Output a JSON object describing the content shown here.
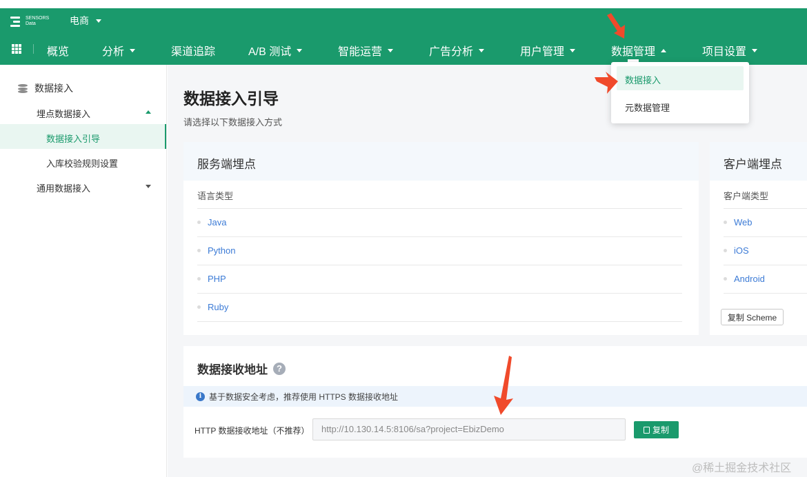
{
  "header": {
    "logo_line1": "SENSORS",
    "logo_line2": "Data",
    "project": "电商",
    "nav": [
      {
        "label": "概览",
        "dropdown": false
      },
      {
        "label": "分析",
        "dropdown": true
      },
      {
        "label": "渠道追踪",
        "dropdown": false
      },
      {
        "label": "A/B 测试",
        "dropdown": true
      },
      {
        "label": "智能运营",
        "dropdown": true
      },
      {
        "label": "广告分析",
        "dropdown": true
      },
      {
        "label": "用户管理",
        "dropdown": true
      },
      {
        "label": "数据管理",
        "dropdown": true,
        "open": true
      },
      {
        "label": "项目设置",
        "dropdown": true
      }
    ]
  },
  "dropdown_menu": {
    "items": [
      "数据接入",
      "元数据管理"
    ],
    "active": "数据接入"
  },
  "sidebar": {
    "title": "数据接入",
    "group1": "埋点数据接入",
    "sub_items": [
      "数据接入引导",
      "入库校验规则设置"
    ],
    "active": "数据接入引导",
    "group2": "通用数据接入"
  },
  "main": {
    "title": "数据接入引导",
    "subtitle": "请选择以下数据接入方式",
    "server_card": {
      "title": "服务端埋点",
      "column_label": "语言类型",
      "items": [
        "Java",
        "Python",
        "PHP",
        "Ruby"
      ]
    },
    "client_card": {
      "title": "客户端埋点",
      "column_label": "客户端类型",
      "items": [
        "Web",
        "iOS",
        "Android"
      ],
      "button": "复制 Scheme"
    },
    "receive": {
      "title": "数据接收地址",
      "help": "?",
      "notice": "基于数据安全考虑，推荐使用 HTTPS 数据接收地址",
      "address_label": "HTTP 数据接收地址（不推荐）",
      "address_value": "http://10.130.14.5:8106/sa?project=EbizDemo",
      "copy_button": "复制"
    }
  },
  "watermark": "@稀土掘金技术社区",
  "colors": {
    "primary": "#1a9a6c",
    "link": "#3c7bd6",
    "annotation_arrow": "#f04a2b"
  }
}
